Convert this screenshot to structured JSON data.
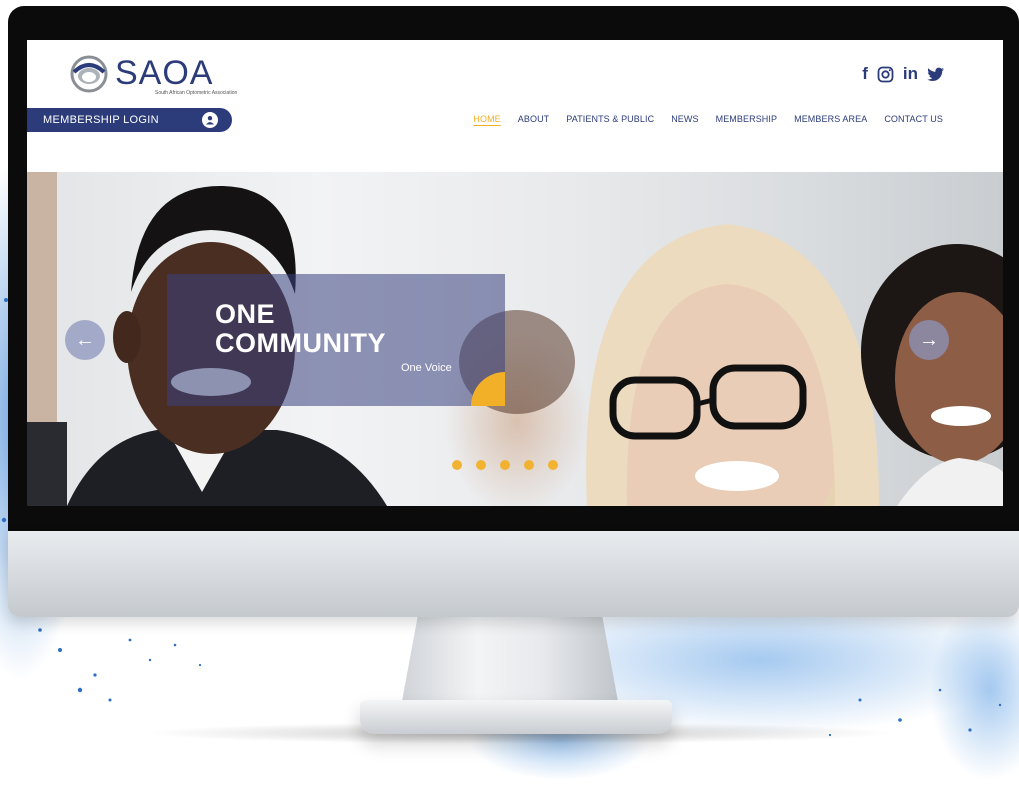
{
  "site": {
    "logo_text": "SAOA",
    "logo_tagline": "South African Optometric Association"
  },
  "social": {
    "icons": [
      "facebook-icon",
      "instagram-icon",
      "linkedin-icon",
      "twitter-icon"
    ],
    "facebook": "f",
    "linkedin": "in"
  },
  "login": {
    "label": "MEMBERSHIP LOGIN",
    "icon": "user-icon"
  },
  "nav": {
    "items": [
      "HOME",
      "ABOUT",
      "PATIENTS & PUBLIC",
      "NEWS",
      "MEMBERSHIP",
      "MEMBERS AREA",
      "CONTACT US"
    ],
    "active": "HOME"
  },
  "hero": {
    "title_line1": "ONE",
    "title_line2": "COMMUNITY",
    "subtitle": "One Voice",
    "prev_arrow": "←",
    "next_arrow": "→",
    "slide_count": 5
  },
  "colors": {
    "brand_navy": "#2c3c7a",
    "accent_gold": "#f2b028",
    "splash_blue": "#3f86d6"
  }
}
